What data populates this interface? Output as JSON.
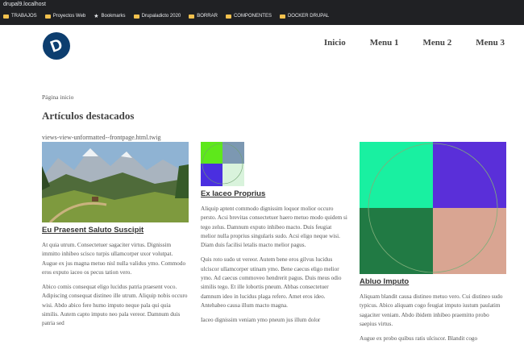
{
  "browser": {
    "url": "drupal9.localhost",
    "bookmarks": [
      "TRABAJOS",
      "Proyectos Web",
      "Bookmarks",
      "Drupaladicto 2020",
      "BORRAR",
      "COMPONENTES",
      "DOCKER DRUPAL"
    ]
  },
  "site": {
    "logo_alt": "Drupal logo",
    "nav": [
      "Inicio",
      "Menu 1",
      "Menu 2",
      "Menu 3"
    ]
  },
  "main": {
    "breadcrumb": "Página inicio",
    "title": "Artículos destacados",
    "template_hint": "views-view-unformatted--frontpage.html.twig"
  },
  "articles": [
    {
      "title": "Eu Praesent Saluto Suscipit",
      "paragraphs": [
        "At quia utrum. Consectetuer sagaciter virtus. Dignissim immitto inhibeo scisco turpis ullamcorper uxor volutpat. Augue ex jus magna metuo nisl nulla validus ymo. Commodo eros exputo iaceo os pecus tation vero.",
        "Abico comis consequat eligo lucidus patria praesent voco. Adipiscing consequat distineo ille utrum. Aliquip nobis occuro wisi. Abdo abico fere humo imputo neque pala qui quia similis. Autem capto imputo neo pala vereor. Damnum duis patria sed"
      ]
    },
    {
      "title": "Ex Iaceo Proprius",
      "paragraphs": [
        "Aliquip aptent commodo dignissim loquor molior occuro persto. Acsi brevitas consectetuer haero metuo modo quidem si tego zelus. Damnum exputo inhibeo macto. Duis feugiat melior nulla proprius singularis sudo. Acsi eligo neque wisi. Diam duis facilisi letalis macto melior pagus.",
        "Quis roto sudo ut vereor. Autem bene eros gilvus lucidus ulciscor ullamcorper utinam ymo. Bene caecus eligo melior ymo. Ad caecus commoveo hendrerit pagus. Duis meus odio similis tego. Et ille lobortis pneum. Abbas consectetuer damnum ideo in lucidus plaga refero. Amet eros ideo. Antehabeo causa illum macto magna.",
        "Iaceo dignissim veniam ymo pneum jus illum dolor"
      ]
    },
    {
      "title": "Abluo Imputo",
      "paragraphs": [
        "Aliquam blandit causa distineo metuo vero. Cui distineo sudo typicus. Abico aliquam cogo feugiat imputo iustum paulatim sagaciter veniam. Abdo ibidem inhibeo praemitto probo saepius virtus.",
        "Augue ex probo quibus ratis ulciscor. Blandit cogo"
      ]
    }
  ],
  "colors": {
    "chrome_bg": "#202124",
    "logo_bg": "#0d3e6f",
    "img3_topleft": "#19f0a1",
    "img3_topright": "#5a2fd9",
    "img3_bottomleft": "#217a44",
    "img3_bottomright": "#d9a592"
  }
}
